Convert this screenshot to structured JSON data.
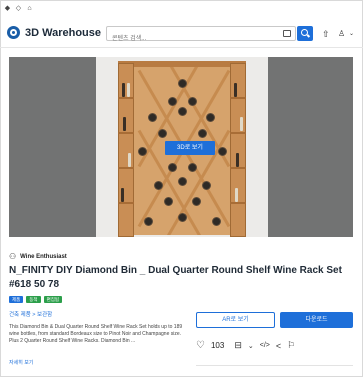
{
  "chrome": {
    "icons": [
      "diamond-icon",
      "diamond-icon",
      "home-icon"
    ]
  },
  "header": {
    "logo": "3D Warehouse",
    "search_placeholder": "콘텐츠 검색...",
    "brand_color": "#1e6fd9"
  },
  "preview": {
    "cta": "3D로 보기"
  },
  "model": {
    "author": "Wine Enthusiast",
    "title": "N_FINITY DIY Diamond Bin _ Dual Quarter Round Shelf Wine Rack Set #618 50 78",
    "badges": [
      "제품",
      "동적",
      "편집됨"
    ],
    "breadcrumb": "건축 제품 > 보관함",
    "description": "This Diamond Bin & Dual Quarter Round Shelf Wine Rack Set holds up to 189 wine bottles, from standard Bordeaux size to Pinot Noir and Champagne size. Plus 2 Quarter Round Shelf Wine Racks. Diamond Bin ...",
    "more": "자세히 보기"
  },
  "actions": {
    "ar_button": "AR로 보기",
    "download_button": "다운로드",
    "likes": "103"
  }
}
